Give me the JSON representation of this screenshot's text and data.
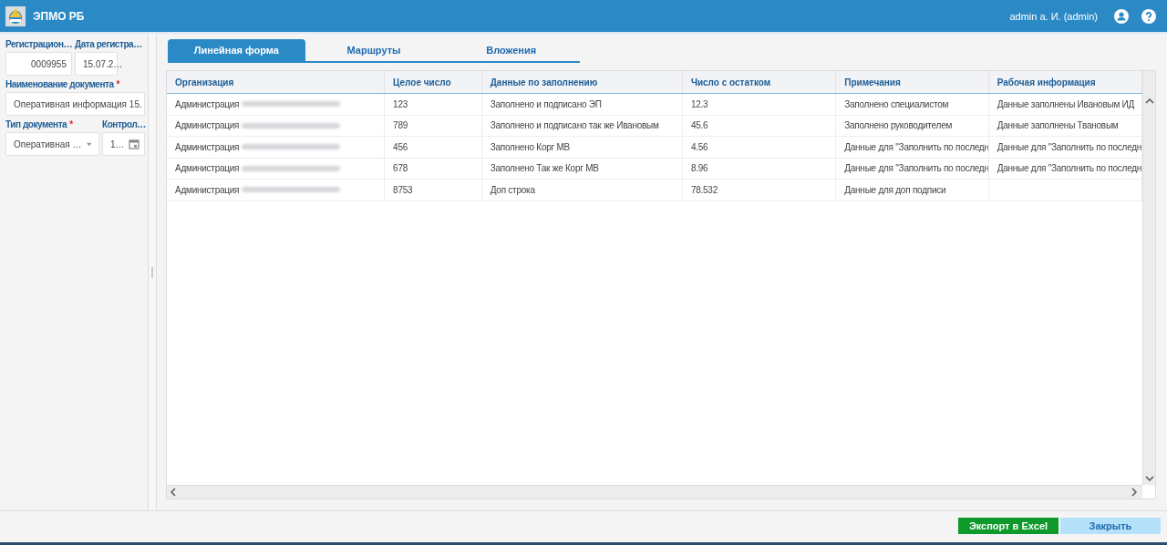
{
  "header": {
    "app_name": "ЭПМО РБ",
    "user": "admin а. И. (admin)"
  },
  "form": {
    "required_mark": "*",
    "rows": [
      {
        "fields": [
          {
            "kind": "number",
            "label": "Регистрацион…",
            "required": false,
            "value": "0009955"
          },
          {
            "kind": "date",
            "label": "Дата регистра…",
            "required": false,
            "value": "15.07.2…"
          }
        ]
      },
      {
        "fields": [
          {
            "kind": "text",
            "label": "Наименование документа",
            "required": true,
            "value": "Оперативная информация 15."
          }
        ]
      },
      {
        "fields": [
          {
            "kind": "select",
            "label": "Тип документа",
            "required": true,
            "value": "Оперативная …"
          },
          {
            "kind": "date",
            "label": "Контрол…",
            "required": false,
            "value": "1…"
          }
        ]
      }
    ]
  },
  "tabs": [
    {
      "label": "Линейная форма",
      "selected": true
    },
    {
      "label": "Маршруты",
      "selected": false
    },
    {
      "label": "Вложения",
      "selected": false
    }
  ],
  "table": {
    "columns": [
      "Организация",
      "Целое число",
      "Данные по заполнению",
      "Число с остатком",
      "Примечания",
      "Рабочая информация"
    ],
    "rows": [
      [
        "Администрация",
        "123",
        "Заполнено и подписано ЭП",
        "12.3",
        "Заполнено специалистом",
        "Данные заполнены Ивановым ИД"
      ],
      [
        "Администрация",
        "789",
        "Заполнено и подписано так же Ивановым",
        "45.6",
        "Заполнено руководителем",
        "Данные заполнены Твановым"
      ],
      [
        "Администрация",
        "456",
        "Заполнено Корг МВ",
        "4.56",
        "Данные для \"Заполнить по последн",
        "Данные для \"Заполнить по последн"
      ],
      [
        "Администрация",
        "678",
        "Заполнено Так же Корг МВ",
        "8.96",
        "Данные для \"Заполнить по последн",
        "Данные для \"Заполнить по последн"
      ],
      [
        "Администрация",
        "8753",
        "Доп строка",
        "78.532",
        "Данные для доп подписи",
        ""
      ]
    ]
  },
  "buttons": [
    {
      "kind": "primary",
      "label": "Экспорт в Excel"
    },
    {
      "kind": "secondary",
      "label": "Закрыть"
    }
  ]
}
